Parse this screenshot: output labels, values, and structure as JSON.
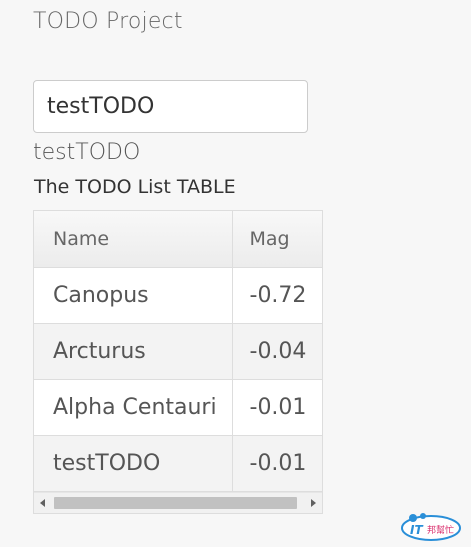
{
  "page": {
    "title": "TODO Project"
  },
  "todo_input": {
    "value": "testTODO"
  },
  "echo_text": "testTODO",
  "table": {
    "heading": "The TODO List TABLE",
    "columns": [
      "Name",
      "Mag"
    ],
    "rows": [
      {
        "name": "Canopus",
        "mag": "-0.72"
      },
      {
        "name": "Arcturus",
        "mag": "-0.04"
      },
      {
        "name": "Alpha Centauri",
        "mag": "-0.01"
      },
      {
        "name": "testTODO",
        "mag": "-0.01"
      }
    ]
  },
  "watermark": {
    "text_latin": "IT",
    "text_cjk": "邦幫忙"
  },
  "colors": {
    "page_bg": "#f7f7f7",
    "border": "#dddddd",
    "stripe": "#f3f3f3",
    "watermark_blue": "#2a8fd8"
  }
}
